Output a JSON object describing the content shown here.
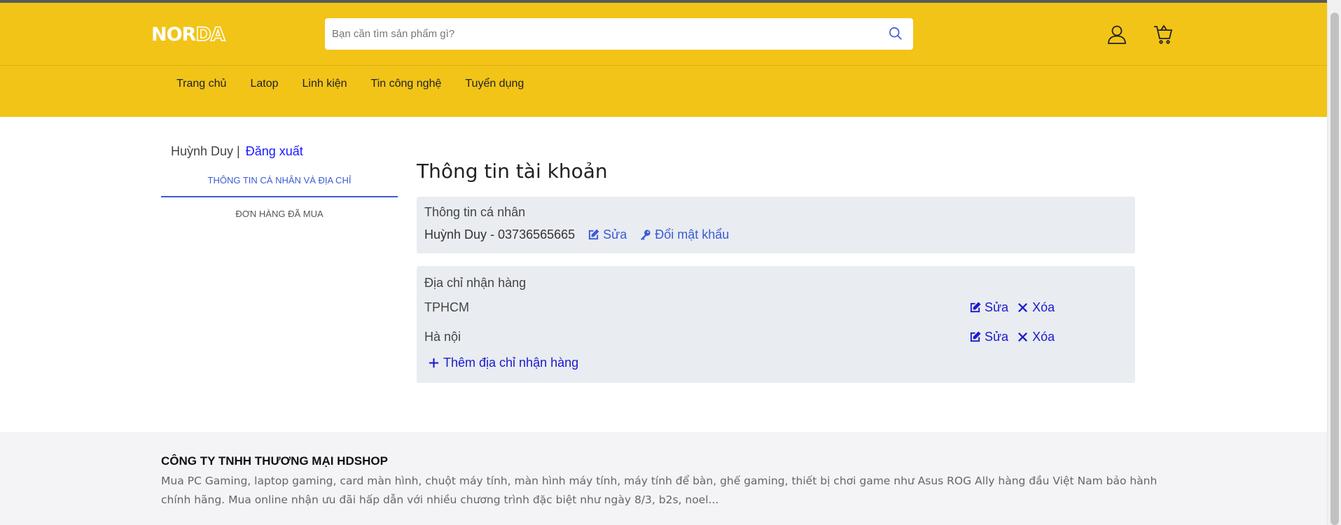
{
  "header": {
    "logo_part1": "NOR",
    "logo_part2": "DA",
    "search_placeholder": "Bạn cần tìm sản phẩm gì?",
    "nav": [
      "Trang chủ",
      "Latop",
      "Linh kiện",
      "Tin công nghệ",
      "Tuyển dụng"
    ],
    "icons": [
      "search-icon",
      "user-icon",
      "cart-icon"
    ],
    "accent_color": "#f2c418"
  },
  "sidebar": {
    "user_name": "Huỳnh Duy |",
    "logout": "Đăng xuất",
    "tabs": [
      "THÔNG TIN CÁ NHÂN VÀ ĐỊA CHỈ",
      "ĐƠN HÀNG ĐÃ MUA"
    ]
  },
  "main": {
    "title": "Thông tin tài khoản",
    "personal": {
      "label": "Thông tin cá nhân",
      "info": "Huỳnh Duy - 03736565665",
      "edit": "Sửa",
      "change_password": "Đổi mật khẩu"
    },
    "addresses": {
      "label": "Địa chỉ nhận hàng",
      "items": [
        {
          "name": "TPHCM",
          "edit": "Sửa",
          "delete": "Xóa"
        },
        {
          "name": "Hà nội",
          "edit": "Sửa",
          "delete": "Xóa"
        }
      ],
      "add": "Thêm địa chỉ nhận hàng"
    }
  },
  "footer": {
    "company": "CÔNG TY TNHH THƯƠNG MẠI HDSHOP",
    "description": "Mua PC Gaming, laptop gaming, card màn hình, chuột máy tính, màn hình máy tính, máy tính để bàn, ghế gaming, thiết bị chơi game như Asus ROG Ally hàng đầu Việt Nam bảo hành chính hãng. Mua online nhận ưu đãi hấp dẫn với nhiều chương trình đặc biệt như ngày 8/3, b2s, noel..."
  }
}
